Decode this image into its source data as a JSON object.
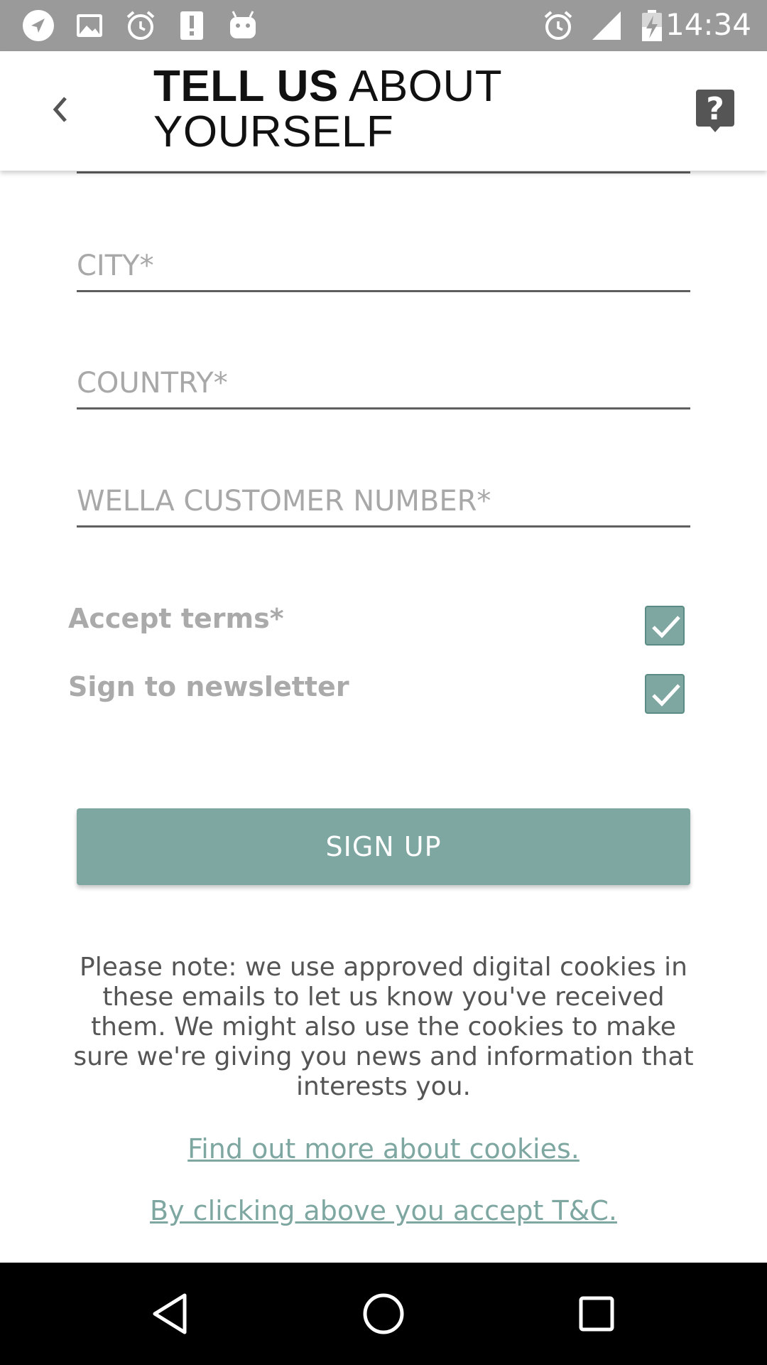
{
  "status_bar": {
    "time": "14:34",
    "left_icons": [
      "navigation-icon",
      "image-icon",
      "alarm-icon",
      "alert-icon",
      "android-icon"
    ],
    "right_icons": [
      "alarm-icon",
      "signal-icon",
      "battery-charging-icon"
    ]
  },
  "header": {
    "title_bold": "TELL US",
    "title_regular": "ABOUT",
    "title_line2": "YOURSELF",
    "back_icon": "chevron-left-icon",
    "help_icon": "help-icon"
  },
  "form": {
    "city_placeholder": "CITY*",
    "country_placeholder": "COUNTRY*",
    "customer_number_placeholder": "WELLA CUSTOMER NUMBER*",
    "accept_terms_label": "Accept terms*",
    "accept_terms_checked": true,
    "newsletter_label": "Sign to newsletter",
    "newsletter_checked": true,
    "signup_label": "SIGN UP"
  },
  "note": "Please note: we use approved digital cookies in these emails to let us know you've received them. We might also use the cookies to make sure we're giving you news and information that interests you.",
  "links": {
    "cookies": "Find out more about cookies.",
    "terms": "By clicking above you accept T&C."
  },
  "colors": {
    "accent": "#7ea7a1",
    "status_bar": "#9a9a9a",
    "nav_bar": "#000000"
  }
}
